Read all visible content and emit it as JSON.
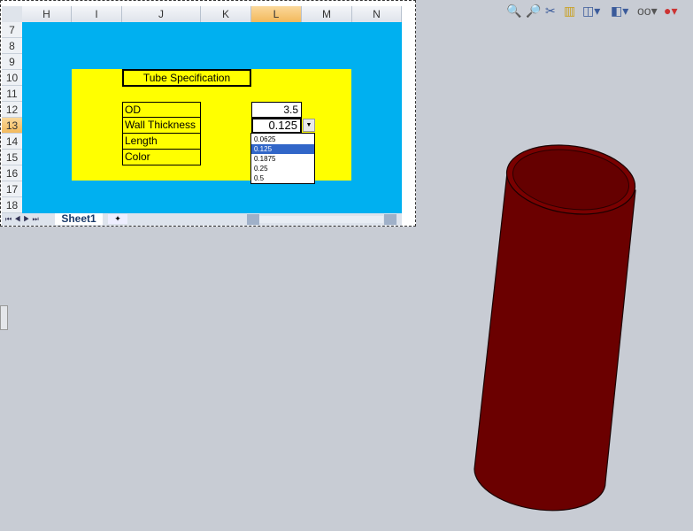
{
  "sheet": {
    "columns": [
      "H",
      "I",
      "J",
      "K",
      "L",
      "M",
      "N"
    ],
    "rows": [
      "7",
      "8",
      "9",
      "10",
      "11",
      "12",
      "13",
      "14",
      "15",
      "16",
      "17",
      "18"
    ],
    "title": "Tube Specification",
    "labels": [
      "OD",
      "Wall Thickness",
      "Length",
      "Color"
    ],
    "od_value": "3.5",
    "wall_value": "0.125",
    "options": [
      "0.0625",
      "0.125",
      "0.1875",
      "0.25",
      "0.5"
    ],
    "tab": "Sheet1",
    "nav": [
      "⏮",
      "◀",
      "▶",
      "⏭"
    ]
  },
  "toolbar": {
    "icons": [
      "zoom-to-fit-icon",
      "zoom-to-area-icon",
      "previous-view-icon",
      "section-view-icon",
      "view-orientation-icon",
      "display-style-icon",
      "hide-show-icon",
      "appearance-icon"
    ]
  },
  "colors": {
    "fill": "#00b0f0",
    "box": "#ffff00",
    "tube": "#6b0000"
  }
}
